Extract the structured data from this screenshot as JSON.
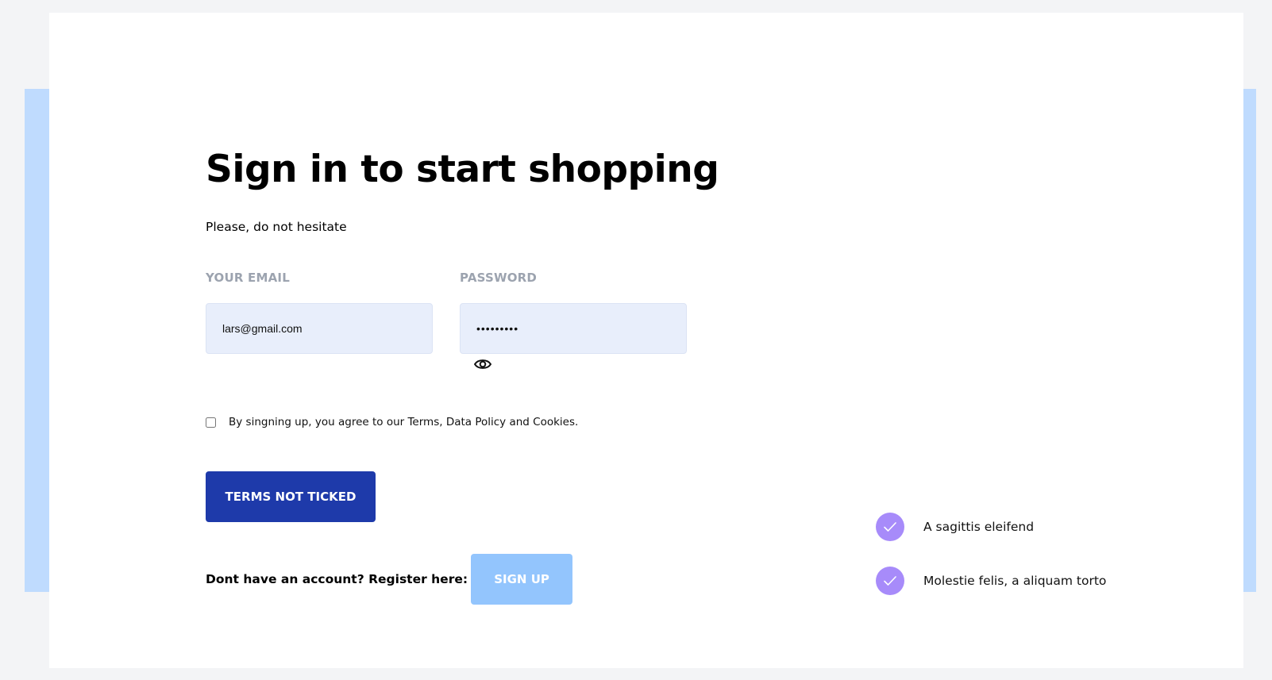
{
  "login": {
    "title": "Sign in to start shopping",
    "subtitle": "Please, do not hesitate",
    "email": {
      "label": "YOUR EMAIL",
      "value": "lars@gmail.com"
    },
    "password": {
      "label": "PASSWORD",
      "value": "•••••••••",
      "toggle_icon": "eye-icon"
    },
    "terms": {
      "checked": false,
      "text": "By singning up, you agree to our Terms, Data Policy and Cookies."
    },
    "submit_label": "TERMS NOT TICKED",
    "register": {
      "prompt": "Dont have an account? Register here:",
      "button_label": "SIGN UP"
    }
  },
  "features": [
    {
      "icon": "check-icon",
      "text": "A sagittis eleifend"
    },
    {
      "icon": "check-icon",
      "text": "Molestie felis, a aliquam torto"
    }
  ],
  "colors": {
    "page_background": "#f3f4f6",
    "band": "#bfdbfe",
    "card": "#ffffff",
    "input_background": "#e8eefb",
    "label_gray": "#9ca3af",
    "primary_button": "#1e3aaa",
    "signup_button": "#93c5fd",
    "check_circle": "#a78bfa"
  }
}
